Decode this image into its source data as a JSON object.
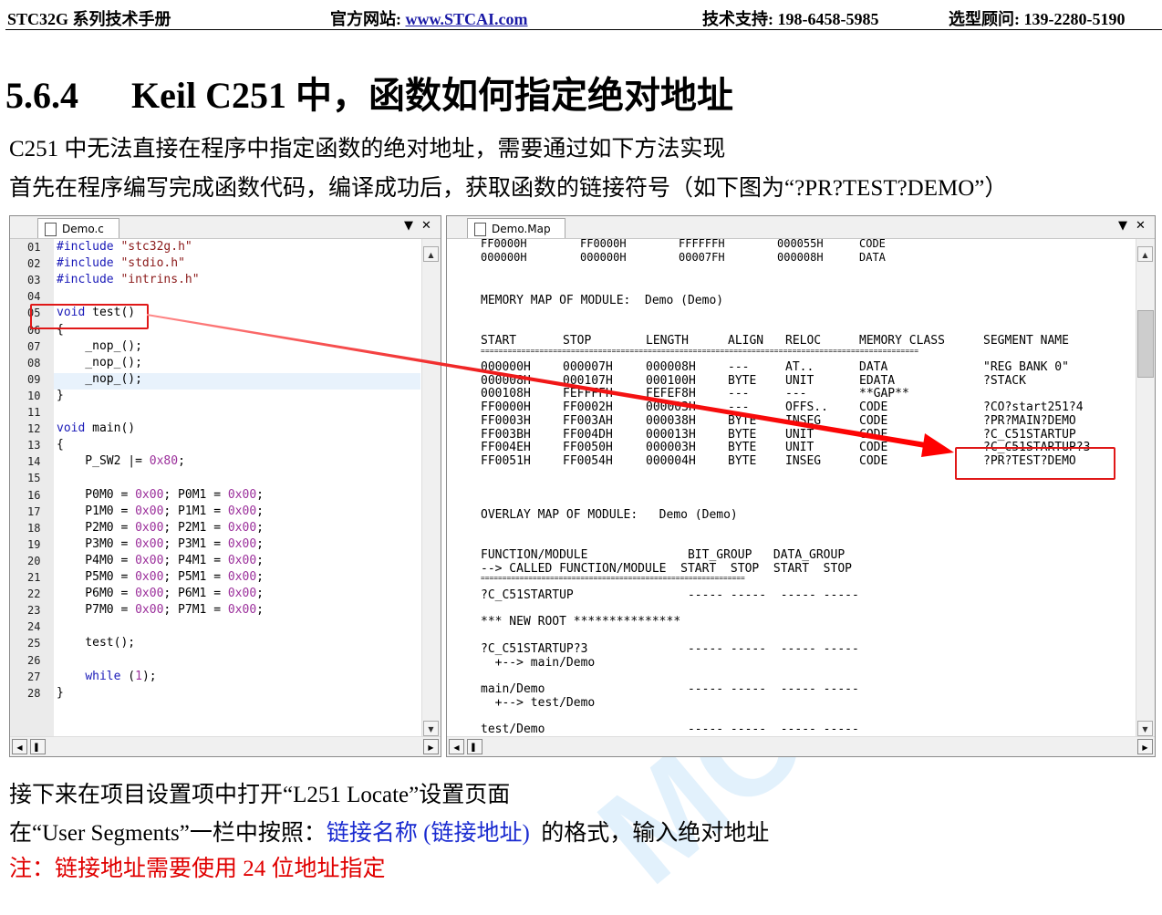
{
  "header": {
    "left": "STC32G 系列技术手册",
    "site_label": "官方网站: ",
    "site_link": "www.STCAI.com",
    "support": "技术支持: 198-6458-5985",
    "advisor": "选型顾问: 139-2280-5190"
  },
  "section": {
    "number": "5.6.4",
    "title": "Keil C251 中，函数如何指定绝对地址"
  },
  "intro": [
    "C251 中无法直接在程序中指定函数的绝对地址，需要通过如下方法实现",
    "首先在程序编写完成函数代码，编译成功后，获取函数的链接符号（如下图为“?PR?TEST?DEMO”）"
  ],
  "editor": {
    "tab": "Demo.c",
    "lines": [
      {
        "n": "01",
        "t": "#include \"stc32g.h\""
      },
      {
        "n": "02",
        "t": "#include \"stdio.h\""
      },
      {
        "n": "03",
        "t": "#include \"intrins.h\""
      },
      {
        "n": "04",
        "t": ""
      },
      {
        "n": "05",
        "t": "void test()"
      },
      {
        "n": "06",
        "t": "{"
      },
      {
        "n": "07",
        "t": "    _nop_();"
      },
      {
        "n": "08",
        "t": "    _nop_();"
      },
      {
        "n": "09",
        "t": "    _nop_();"
      },
      {
        "n": "10",
        "t": "}"
      },
      {
        "n": "11",
        "t": ""
      },
      {
        "n": "12",
        "t": "void main()"
      },
      {
        "n": "13",
        "t": "{"
      },
      {
        "n": "14",
        "t": "    P_SW2 |= 0x80;"
      },
      {
        "n": "15",
        "t": ""
      },
      {
        "n": "16",
        "t": "    P0M0 = 0x00; P0M1 = 0x00;"
      },
      {
        "n": "17",
        "t": "    P1M0 = 0x00; P1M1 = 0x00;"
      },
      {
        "n": "18",
        "t": "    P2M0 = 0x00; P2M1 = 0x00;"
      },
      {
        "n": "19",
        "t": "    P3M0 = 0x00; P3M1 = 0x00;"
      },
      {
        "n": "20",
        "t": "    P4M0 = 0x00; P4M1 = 0x00;"
      },
      {
        "n": "21",
        "t": "    P5M0 = 0x00; P5M1 = 0x00;"
      },
      {
        "n": "22",
        "t": "    P6M0 = 0x00; P6M1 = 0x00;"
      },
      {
        "n": "23",
        "t": "    P7M0 = 0x00; P7M1 = 0x00;"
      },
      {
        "n": "24",
        "t": ""
      },
      {
        "n": "25",
        "t": "    test();"
      },
      {
        "n": "26",
        "t": ""
      },
      {
        "n": "27",
        "t": "    while (1);"
      },
      {
        "n": "28",
        "t": "}"
      }
    ]
  },
  "map": {
    "tab": "Demo.Map",
    "top_rows": [
      [
        "FF0000H",
        "FF0000H",
        "FFFFFFH",
        "000055H",
        "CODE"
      ],
      [
        "000000H",
        "000000H",
        "00007FH",
        "000008H",
        "DATA"
      ]
    ],
    "module_heading": "MEMORY MAP OF MODULE:  Demo (Demo)",
    "columns": [
      "START",
      "STOP",
      "LENGTH",
      "ALIGN",
      "RELOC",
      "MEMORY CLASS",
      "SEGMENT NAME"
    ],
    "rule": "=================================================================================================",
    "rows": [
      [
        "000000H",
        "000007H",
        "000008H",
        "---",
        "AT..",
        "DATA",
        "\"REG BANK 0\""
      ],
      [
        "000008H",
        "000107H",
        "000100H",
        "BYTE",
        "UNIT",
        "EDATA",
        "?STACK"
      ],
      [
        "000108H",
        "FEFFFFH",
        "FEFEF8H",
        "---",
        "---",
        "**GAP**",
        ""
      ],
      [
        "FF0000H",
        "FF0002H",
        "000003H",
        "---",
        "OFFS..",
        "CODE",
        "?CO?start251?4"
      ],
      [
        "FF0003H",
        "FF003AH",
        "000038H",
        "BYTE",
        "INSEG",
        "CODE",
        "?PR?MAIN?DEMO"
      ],
      [
        "FF003BH",
        "FF004DH",
        "000013H",
        "BYTE",
        "UNIT",
        "CODE",
        "?C_C51STARTUP"
      ],
      [
        "FF004EH",
        "FF0050H",
        "000003H",
        "BYTE",
        "UNIT",
        "CODE",
        "?C_C51STARTUP?3"
      ],
      [
        "FF0051H",
        "FF0054H",
        "000004H",
        "BYTE",
        "INSEG",
        "CODE",
        "?PR?TEST?DEMO"
      ]
    ],
    "overlay_heading": "OVERLAY MAP OF MODULE:   Demo (Demo)",
    "overlay_head1": "FUNCTION/MODULE              BIT_GROUP   DATA_GROUP",
    "overlay_head2": "--> CALLED FUNCTION/MODULE  START  STOP  START  STOP",
    "overlay_rule": "=============================================================",
    "overlay_lines": [
      {
        "t": "?C_C51STARTUP                ----- -----  ----- -----"
      },
      {
        "t": ""
      },
      {
        "t": "*** NEW ROOT ***************"
      },
      {
        "t": ""
      },
      {
        "t": "?C_C51STARTUP?3              ----- -----  ----- -----"
      },
      {
        "t": "  +--> main/Demo"
      },
      {
        "t": ""
      },
      {
        "t": "main/Demo                    ----- -----  ----- -----"
      },
      {
        "t": "  +--> test/Demo"
      },
      {
        "t": ""
      },
      {
        "t": "test/Demo                    ----- -----  ----- -----"
      }
    ]
  },
  "after": {
    "line1": "接下来在项目设置项中打开“L251 Locate”设置页面",
    "line2_a": "在“User Segments”一栏中按照：",
    "line2_b": "链接名称 (链接地址)",
    "line2_c": "  的格式，输入绝对地址",
    "note": "注：链接地址需要使用 24 位地址指定"
  },
  "watermark": "MCU",
  "colors": {
    "link": "#1a1aa6",
    "highlight": "#e01818",
    "blue_text": "#1a2bd0",
    "note": "#e00000"
  }
}
